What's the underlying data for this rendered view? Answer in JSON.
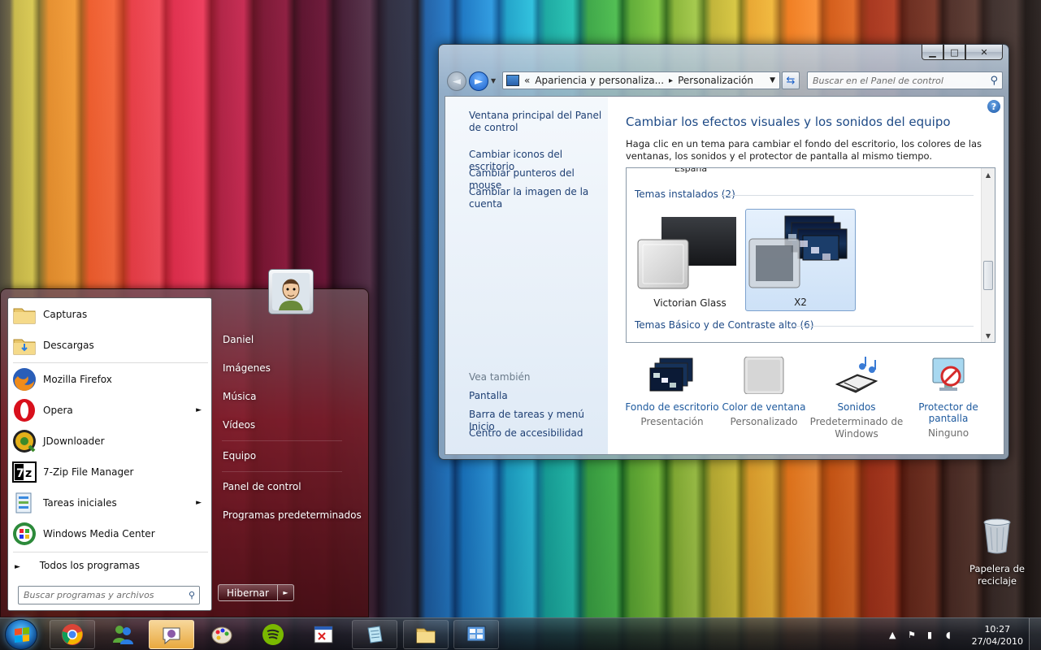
{
  "window": {
    "caption_buttons": {
      "minimize": "▁",
      "maximize": "□",
      "close": "✕"
    },
    "address": {
      "prefix": "«",
      "crumb1": "Apariencia y personaliza...",
      "sep": "▸",
      "crumb2": "Personalización"
    },
    "search_placeholder": "Buscar en el Panel de control",
    "left_pane": {
      "links": [
        "Ventana principal del Panel de control",
        "Cambiar iconos del escritorio",
        "Cambiar punteros del mouse",
        "Cambiar la imagen de la cuenta"
      ],
      "see_also_heading": "Vea también",
      "see_also": [
        "Pantalla",
        "Barra de tareas y menú Inicio",
        "Centro de accesibilidad"
      ]
    },
    "title": "Cambiar los efectos visuales y los sonidos del equipo",
    "description": "Haga clic en un tema para cambiar el fondo del escritorio, los colores de las ventanas, los sonidos y el protector de pantalla al mismo tiempo.",
    "themes": {
      "cut_label": "España",
      "installed_heading": "Temas instalados (2)",
      "items": [
        {
          "name": "Victorian Glass",
          "selected": false
        },
        {
          "name": "X2",
          "selected": true
        }
      ],
      "basic_heading": "Temas Básico y de Contraste alto (6)"
    },
    "bottom_items": [
      {
        "label": "Fondo de escritorio",
        "sub": "Presentación",
        "icon": "desktop-background-icon"
      },
      {
        "label": "Color de ventana",
        "sub": "Personalizado",
        "icon": "window-color-icon"
      },
      {
        "label": "Sonidos",
        "sub": "Predeterminado de Windows",
        "icon": "sounds-icon"
      },
      {
        "label": "Protector de pantalla",
        "sub": "Ninguno",
        "icon": "screensaver-icon"
      }
    ],
    "help": "?"
  },
  "start_menu": {
    "programs": [
      {
        "label": "Capturas",
        "icon": "folder-icon",
        "submenu": false
      },
      {
        "label": "Descargas",
        "icon": "folder-icon",
        "submenu": false
      },
      {
        "label": "Mozilla Firefox",
        "icon": "firefox-icon",
        "submenu": false
      },
      {
        "label": "Opera",
        "icon": "opera-icon",
        "submenu": true
      },
      {
        "label": "JDownloader",
        "icon": "jdownloader-icon",
        "submenu": false
      },
      {
        "label": "7-Zip File Manager",
        "icon": "7zip-icon",
        "submenu": false
      },
      {
        "label": "Tareas iniciales",
        "icon": "getting-started-icon",
        "submenu": true
      },
      {
        "label": "Windows Media Center",
        "icon": "media-center-icon",
        "submenu": false
      }
    ],
    "all_programs": "Todos los programas",
    "search_placeholder": "Buscar programas y archivos",
    "right_items": [
      "Daniel",
      "Imágenes",
      "Música",
      "Vídeos",
      "Equipo",
      "Panel de control",
      "Programas predeterminados"
    ],
    "shutdown_label": "Hibernar"
  },
  "desktop": {
    "recycle_bin": "Papelera de reciclaje"
  },
  "taskbar": {
    "time": "10:27",
    "date": "27/04/2010",
    "buttons": [
      "chrome",
      "messenger",
      "pidgin",
      "paint",
      "spotify",
      "cmd",
      "notepad",
      "explorer",
      "control-panel"
    ]
  },
  "colors": {
    "link": "#1e3f73",
    "title": "#1e4a86",
    "subtext": "#6d6d6d"
  }
}
